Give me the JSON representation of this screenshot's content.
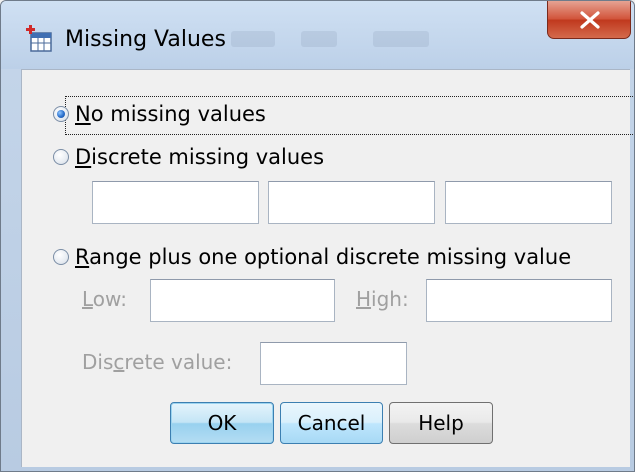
{
  "window": {
    "title": "Missing Values",
    "close_glyph": "X"
  },
  "options": {
    "no_missing": {
      "pre": "",
      "key": "N",
      "post": "o missing values",
      "selected": true
    },
    "discrete": {
      "pre": "",
      "key": "D",
      "post": "iscrete missing values",
      "selected": false,
      "values": [
        "",
        "",
        ""
      ]
    },
    "range": {
      "pre": "",
      "key": "R",
      "post": "ange plus one optional discrete missing value",
      "selected": false
    }
  },
  "range_fields": {
    "low": {
      "key": "L",
      "post": "ow:",
      "value": ""
    },
    "high": {
      "key": "H",
      "post": "igh:",
      "value": ""
    },
    "discrete_value": {
      "pre": "Dis",
      "key": "c",
      "post": "rete value:",
      "value": ""
    }
  },
  "buttons": {
    "ok": "OK",
    "cancel": "Cancel",
    "help": "Help"
  },
  "icons": {
    "app": "spss-data-grid-icon",
    "close": "close-icon"
  },
  "colors": {
    "close_button": "#c0391e",
    "default_button": "#98d1ef",
    "disabled_text": "#a0a0a0"
  }
}
